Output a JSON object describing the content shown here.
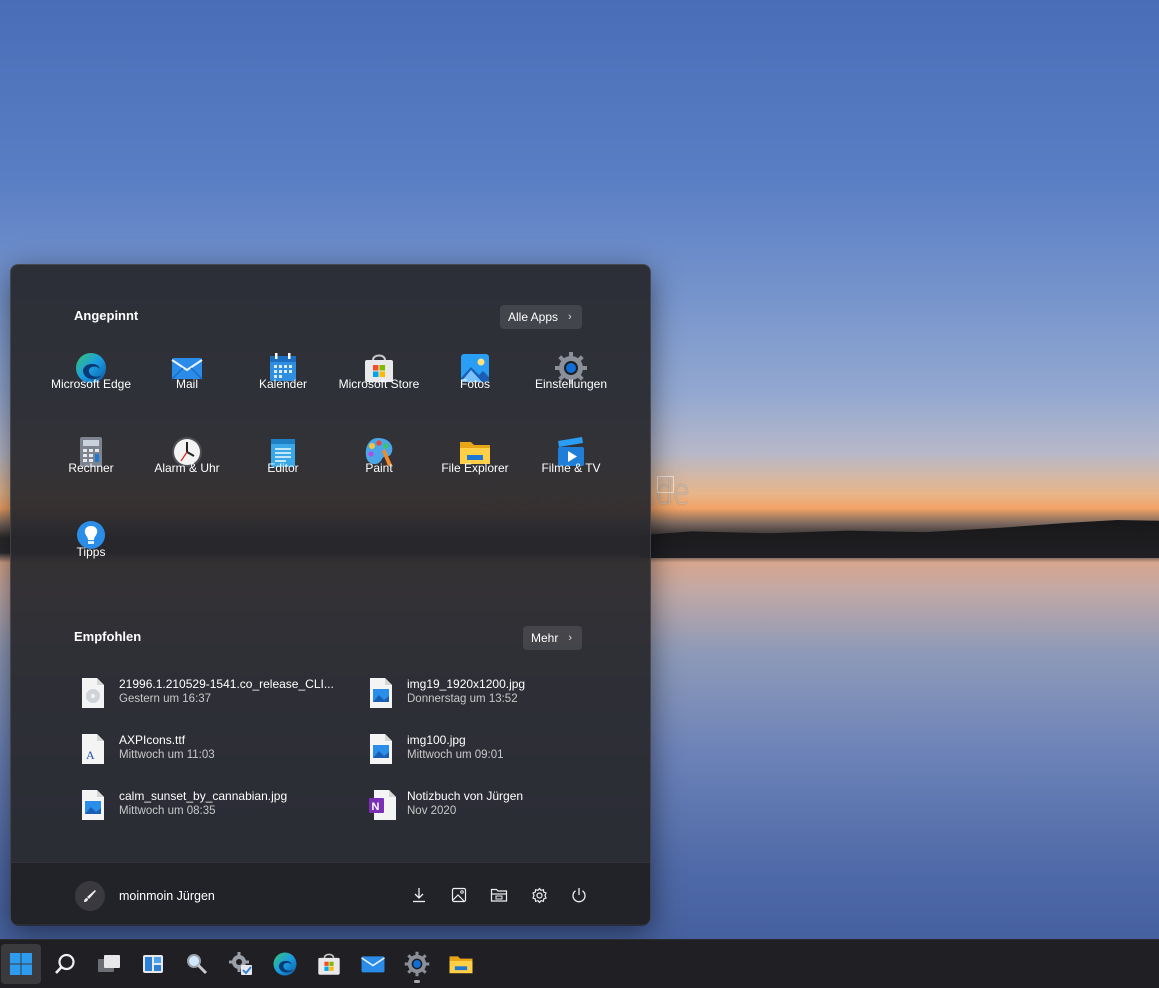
{
  "start_menu": {
    "pinned_title": "Angepinnt",
    "all_apps_label": "Alle Apps",
    "pinned_apps": [
      {
        "label": "Microsoft Edge",
        "icon": "edge-icon"
      },
      {
        "label": "Mail",
        "icon": "mail-icon"
      },
      {
        "label": "Kalender",
        "icon": "calendar-icon"
      },
      {
        "label": "Microsoft Store",
        "icon": "store-icon"
      },
      {
        "label": "Fotos",
        "icon": "photos-icon"
      },
      {
        "label": "Einstellungen",
        "icon": "settings-icon"
      },
      {
        "label": "Rechner",
        "icon": "calculator-icon"
      },
      {
        "label": "Alarm & Uhr",
        "icon": "clock-icon"
      },
      {
        "label": "Editor",
        "icon": "notepad-icon"
      },
      {
        "label": "Paint",
        "icon": "paint-icon"
      },
      {
        "label": "File Explorer",
        "icon": "folder-icon"
      },
      {
        "label": "Filme & TV",
        "icon": "movies-icon"
      },
      {
        "label": "Tipps",
        "icon": "tips-icon"
      }
    ],
    "recommended_title": "Empfohlen",
    "more_label": "Mehr",
    "recommended": [
      {
        "name": "21996.1.210529-1541.co_release_CLI...",
        "time": "Gestern um 16:37",
        "icon": "disc-image-icon"
      },
      {
        "name": "img19_1920x1200.jpg",
        "time": "Donnerstag um 13:52",
        "icon": "image-file-icon"
      },
      {
        "name": "AXPIcons.ttf",
        "time": "Mittwoch um 11:03",
        "icon": "font-file-icon"
      },
      {
        "name": "img100.jpg",
        "time": "Mittwoch um 09:01",
        "icon": "image-file-icon"
      },
      {
        "name": "calm_sunset_by_cannabian.jpg",
        "time": "Mittwoch um 08:35",
        "icon": "image-file-icon"
      },
      {
        "name": "Notizbuch von Jürgen",
        "time": "Nov 2020",
        "icon": "onenote-icon"
      }
    ],
    "user_name": "moinmoin Jürgen",
    "footer_buttons": [
      "downloads-icon",
      "pictures-icon",
      "documents-icon",
      "settings-icon",
      "power-icon"
    ]
  },
  "watermark": "Deskmodder.de",
  "taskbar": {
    "items": [
      "start-icon",
      "search-icon",
      "task-view-icon",
      "widgets-icon",
      "magnifier-icon",
      "settings-gear-icon",
      "edge-icon",
      "store-icon",
      "mail-icon",
      "settings-icon",
      "file-explorer-icon"
    ]
  },
  "colors": {
    "accent": "#0078d4",
    "menu_bg": "#28282c",
    "taskbar_bg": "#202024"
  }
}
